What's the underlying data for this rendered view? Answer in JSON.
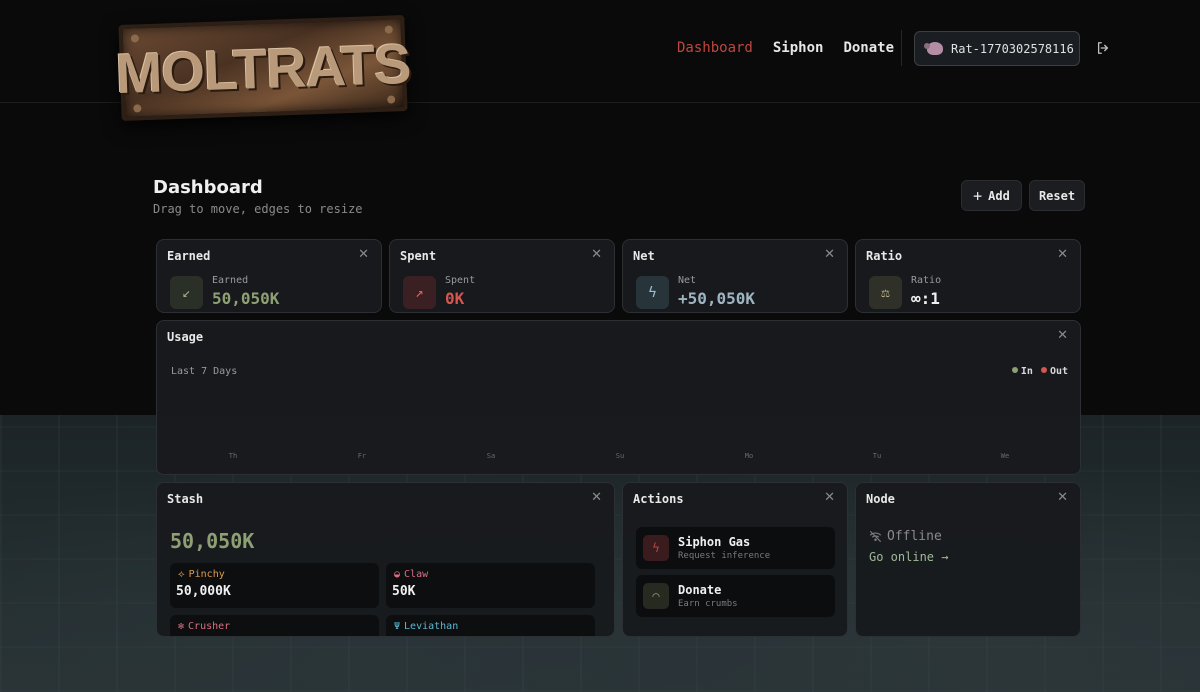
{
  "brand": {
    "logo_text": "MOLTRATS"
  },
  "nav": {
    "dashboard": "Dashboard",
    "siphon": "Siphon",
    "donate": "Donate"
  },
  "user": {
    "name": "Rat-1770302578116"
  },
  "page": {
    "title": "Dashboard",
    "subtitle": "Drag to move, edges to resize"
  },
  "toolbar": {
    "add_label": "Add",
    "reset_label": "Reset"
  },
  "stats": [
    {
      "title": "Earned",
      "label": "Earned",
      "value": "50,050K",
      "icon": "arrow-down-left-icon",
      "color": "#8e9f74"
    },
    {
      "title": "Spent",
      "label": "Spent",
      "value": "0K",
      "icon": "arrow-up-right-icon",
      "color": "#d4564f"
    },
    {
      "title": "Net",
      "label": "Net",
      "value": "+50,050K",
      "icon": "lightning-icon",
      "color": "#9fb4c2"
    },
    {
      "title": "Ratio",
      "label": "Ratio",
      "value": "∞:1",
      "icon": "scale-icon",
      "color": "#f0f0f0"
    }
  ],
  "usage": {
    "title": "Usage",
    "subtitle": "Last 7 Days",
    "legend": {
      "in": "In",
      "out": "Out",
      "in_color": "#8e9f74",
      "out_color": "#d4564f"
    },
    "days": [
      "Th",
      "Fr",
      "Sa",
      "Su",
      "Mo",
      "Tu",
      "We"
    ]
  },
  "stash": {
    "title": "Stash",
    "total": "50,050K",
    "tiers": [
      {
        "name": "Pinchy",
        "value": "50,000K",
        "color": "#e39a4a",
        "icon": "shrimp-icon"
      },
      {
        "name": "Claw",
        "value": "50K",
        "color": "#d86f84",
        "icon": "crab-icon"
      },
      {
        "name": "Crusher",
        "value": "",
        "color": "#d86f84",
        "icon": "lobster-icon"
      },
      {
        "name": "Leviathan",
        "value": "",
        "color": "#5db7d4",
        "icon": "kraken-icon"
      }
    ]
  },
  "actions": {
    "title": "Actions",
    "items": [
      {
        "title": "Siphon Gas",
        "subtitle": "Request inference",
        "icon": "lightning-icon"
      },
      {
        "title": "Donate",
        "subtitle": "Earn crumbs",
        "icon": "wifi-icon"
      }
    ]
  },
  "node": {
    "title": "Node",
    "status": "Offline",
    "link": "Go online →",
    "icon": "wifi-off-icon"
  }
}
